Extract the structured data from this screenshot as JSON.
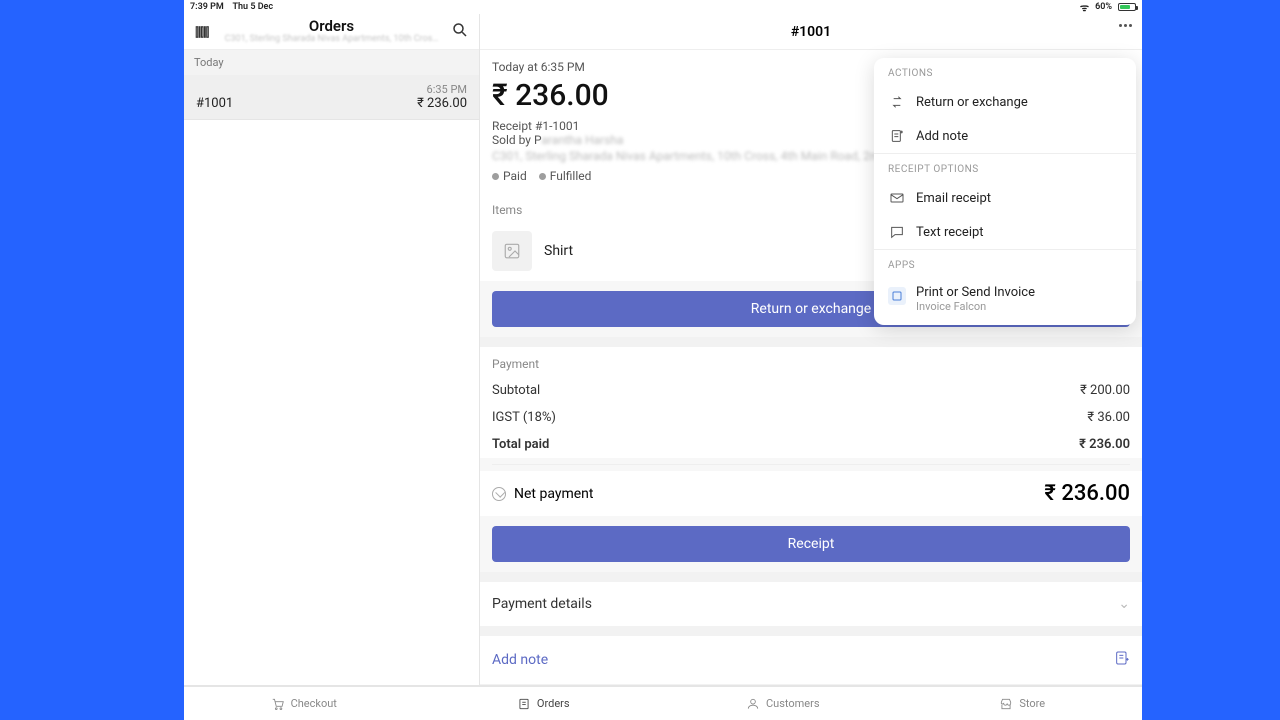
{
  "statusbar": {
    "time": "7:39 PM",
    "date": "Thu 5 Dec",
    "battery_pct": "60%"
  },
  "sidebar": {
    "title": "Orders",
    "subtitle": "C301, Sterling Sharada Nivas Apartments, 10th Cros…",
    "section_label": "Today",
    "order": {
      "time": "6:35 PM",
      "number": "#1001",
      "amount": "₹ 236.00"
    }
  },
  "main": {
    "header_number": "#1001",
    "topinfo": {
      "time": "Today at 6:35 PM",
      "price": "₹ 236.00",
      "receipt": "Receipt #1-1001",
      "sold_by_prefix": "Sold by P",
      "address_blur": "C301, Sterling Sharada Nivas Apartments, 10th Cross, 4th Main Road, 2nd Pha…",
      "status_paid": "Paid",
      "status_fulfilled": "Fulfilled"
    },
    "items_label": "Items",
    "item_name": "Shirt",
    "return_btn": "Return or exchange",
    "payment_label": "Payment",
    "subtotal_label": "Subtotal",
    "subtotal_value": "₹ 200.00",
    "tax_label": "IGST (18%)",
    "tax_value": "₹ 36.00",
    "total_label": "Total paid",
    "total_value": "₹ 236.00",
    "net_label": "Net payment",
    "net_value": "₹ 236.00",
    "receipt_btn": "Receipt",
    "details_label": "Payment details",
    "add_note_label": "Add note"
  },
  "popover": {
    "actions_label": "ACTIONS",
    "return": "Return or exchange",
    "add_note": "Add note",
    "receipt_options_label": "RECEIPT OPTIONS",
    "email": "Email receipt",
    "text": "Text receipt",
    "apps_label": "APPS",
    "app_name": "Print or Send Invoice",
    "app_vendor": "Invoice Falcon"
  },
  "tabs": {
    "checkout": "Checkout",
    "orders": "Orders",
    "customers": "Customers",
    "store": "Store"
  }
}
